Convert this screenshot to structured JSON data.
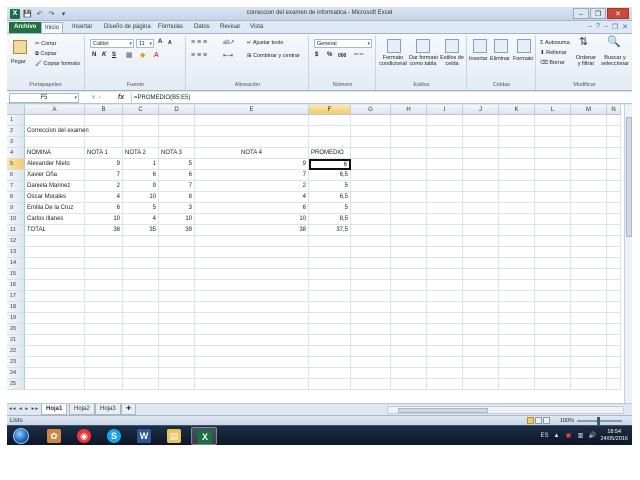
{
  "window": {
    "title": "correccion del examen de informatica - Microsoft Excel",
    "app_icon": "X",
    "qat_save": "💾",
    "qat_undo": "↶",
    "qat_redo": "↷",
    "qat_more": "▾",
    "minimize": "–",
    "maximize": "❐",
    "close": "✕"
  },
  "ribbon_tabs": {
    "file": "Archivo",
    "items": [
      "Inicio",
      "Insertar",
      "Diseño de página",
      "Fórmulas",
      "Datos",
      "Revisar",
      "Vista"
    ],
    "help": "?",
    "min": "–",
    "restore": "❐",
    "close": "✕"
  },
  "ribbon": {
    "clipboard": {
      "paste": "Pegar",
      "cut": "Cortar",
      "copy": "Copiar",
      "format_painter": "Copiar formato",
      "label": "Portapapeles"
    },
    "font": {
      "name": "Calibri",
      "size": "11",
      "grow": "A",
      "shrink": "A",
      "bold": "N",
      "italic": "K",
      "underline": "S",
      "label": "Fuente"
    },
    "alignment": {
      "wrap": "Ajustar texto",
      "merge": "Combinar y centrar",
      "label": "Alineación"
    },
    "number": {
      "format": "General",
      "currency": "$",
      "percent": "%",
      "thousands": "000",
      "label": "Número"
    },
    "styles": {
      "conditional_line1": "Formato",
      "conditional_line2": "condicional",
      "as_table_line1": "Dar formato",
      "as_table_line2": "como tabla",
      "cell_styles_line1": "Estilos de",
      "cell_styles_line2": "celda",
      "label": "Estilos"
    },
    "cells": {
      "insert": "Insertar",
      "delete": "Eliminar",
      "format": "Formato",
      "label": "Celdas"
    },
    "editing": {
      "autosum": "Autosuma",
      "fill": "Rellenar",
      "clear": "Borrar",
      "sort_line1": "Ordenar",
      "sort_line2": "y filtrar",
      "find_line1": "Buscar y",
      "find_line2": "seleccionar",
      "label": "Modificar"
    }
  },
  "formula_bar": {
    "name_box": "F5",
    "fx": "fx",
    "formula": "=PROMEDIO(B5:E5)"
  },
  "grid": {
    "columns": [
      "A",
      "B",
      "C",
      "D",
      "E",
      "F",
      "G",
      "H",
      "I",
      "J",
      "K",
      "L",
      "M",
      "N"
    ],
    "rows": [
      "1",
      "2",
      "3",
      "4",
      "5",
      "6",
      "7",
      "8",
      "9",
      "10",
      "11",
      "12",
      "13",
      "14",
      "15",
      "16",
      "17",
      "18",
      "19",
      "20",
      "21",
      "22",
      "23",
      "24",
      "25"
    ],
    "title": "Correccion del examen",
    "headers": [
      "NOMINA",
      "NOTA 1",
      "NOTA 2",
      "NOTA 3",
      "NOTA 4",
      "PROMEDIO"
    ],
    "data": [
      [
        "Alexander Nieto",
        "9",
        "1",
        "5",
        "9",
        "6"
      ],
      [
        "Xavier Oña",
        "7",
        "6",
        "6",
        "7",
        "6,5"
      ],
      [
        "Daniela Marinez",
        "2",
        "9",
        "7",
        "2",
        "5"
      ],
      [
        "Oscar Morales",
        "4",
        "10",
        "8",
        "4",
        "6,5"
      ],
      [
        "Emilia De la Cruz",
        "6",
        "5",
        "3",
        "6",
        "5"
      ],
      [
        "Carlos Illanes",
        "10",
        "4",
        "10",
        "10",
        "8,5"
      ],
      [
        "TOTAL",
        "38",
        "35",
        "39",
        "38",
        "37,5"
      ]
    ]
  },
  "sheets": {
    "nav": "◂◂ ◂ ▸ ▸▸",
    "tabs": [
      "Hoja1",
      "Hoja2",
      "Hoja3"
    ]
  },
  "status": {
    "mode": "Listo",
    "zoom": "100%"
  },
  "taskbar": {
    "language": "ES",
    "time": "18:54",
    "date": "24/05/2016"
  }
}
